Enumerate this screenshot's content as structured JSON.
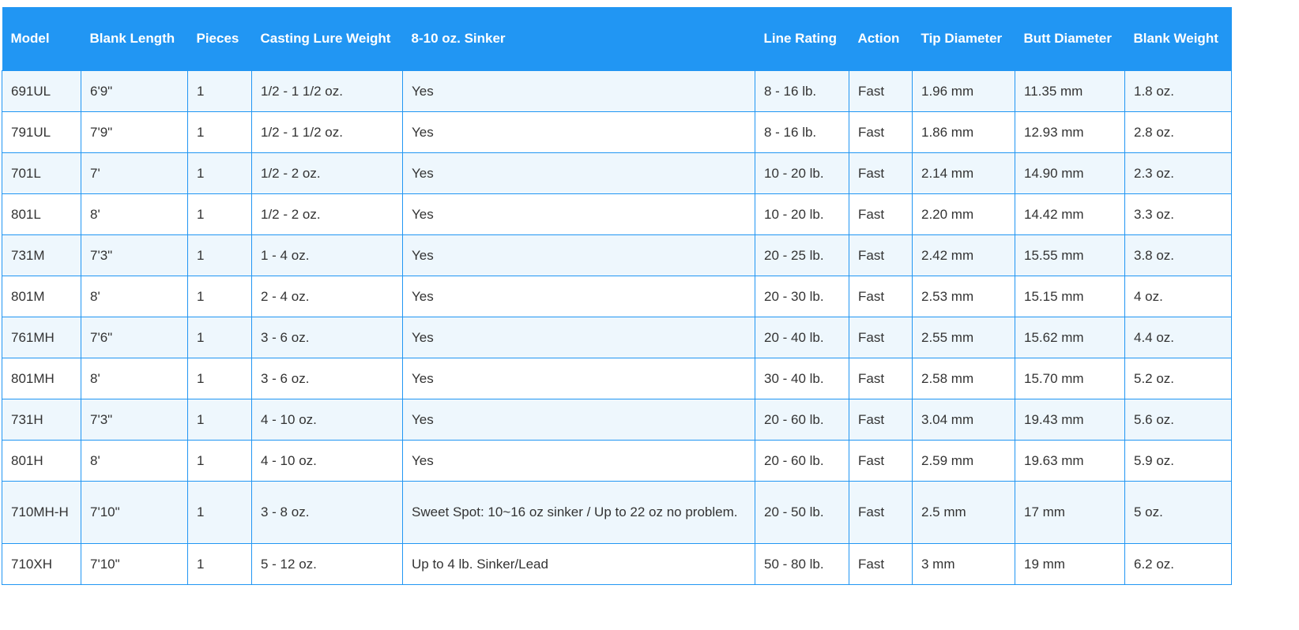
{
  "accent_color": "#2196f3",
  "stripe_color": "#eef7fd",
  "table": {
    "headers": [
      "Model",
      "Blank Length",
      "Pieces",
      "Casting Lure Weight",
      "8-10 oz. Sinker",
      "Line Rating",
      "Action",
      "Tip Diameter",
      "Butt Diameter",
      "Blank Weight"
    ],
    "rows": [
      [
        "691UL",
        "6'9\"",
        "1",
        "1/2 - 1 1/2 oz.",
        "Yes",
        "8 - 16 lb.",
        "Fast",
        "1.96 mm",
        "11.35 mm",
        "1.8 oz."
      ],
      [
        "791UL",
        "7'9\"",
        "1",
        "1/2 - 1 1/2 oz.",
        "Yes",
        "8 - 16 lb.",
        "Fast",
        "1.86 mm",
        "12.93 mm",
        "2.8 oz."
      ],
      [
        "701L",
        "7'",
        "1",
        "1/2 - 2 oz.",
        "Yes",
        "10 - 20 lb.",
        "Fast",
        "2.14 mm",
        "14.90 mm",
        "2.3 oz."
      ],
      [
        "801L",
        "8'",
        "1",
        "1/2 - 2 oz.",
        "Yes",
        "10 - 20 lb.",
        "Fast",
        "2.20 mm",
        "14.42 mm",
        "3.3 oz."
      ],
      [
        "731M",
        "7'3\"",
        "1",
        "1 - 4 oz.",
        "Yes",
        "20 - 25 lb.",
        "Fast",
        "2.42 mm",
        "15.55 mm",
        "3.8 oz."
      ],
      [
        "801M",
        "8'",
        "1",
        "2 - 4 oz.",
        "Yes",
        "20 - 30 lb.",
        "Fast",
        "2.53 mm",
        "15.15 mm",
        "4 oz."
      ],
      [
        "761MH",
        "7'6\"",
        "1",
        "3 - 6 oz.",
        "Yes",
        "20 - 40 lb.",
        "Fast",
        "2.55 mm",
        "15.62 mm",
        "4.4 oz."
      ],
      [
        "801MH",
        "8'",
        "1",
        "3 - 6 oz.",
        "Yes",
        "30 - 40 lb.",
        "Fast",
        "2.58 mm",
        "15.70 mm",
        "5.2 oz."
      ],
      [
        "731H",
        "7'3\"",
        "1",
        "4 - 10 oz.",
        "Yes",
        "20 - 60 lb.",
        "Fast",
        "3.04 mm",
        "19.43 mm",
        "5.6 oz."
      ],
      [
        "801H",
        "8'",
        "1",
        "4 - 10 oz.",
        "Yes",
        "20 - 60 lb.",
        "Fast",
        "2.59 mm",
        "19.63 mm",
        "5.9 oz."
      ],
      [
        "710MH-H",
        "7'10\"",
        "1",
        "3 - 8 oz.",
        "Sweet Spot: 10~16 oz sinker / Up to 22 oz no problem.",
        "20 - 50 lb.",
        "Fast",
        "2.5 mm",
        "17 mm",
        "5 oz."
      ],
      [
        "710XH",
        "7'10\"",
        "1",
        "5 - 12 oz.",
        "Up to 4 lb. Sinker/Lead",
        "50 - 80 lb.",
        "Fast",
        "3 mm",
        "19 mm",
        "6.2 oz."
      ]
    ]
  }
}
